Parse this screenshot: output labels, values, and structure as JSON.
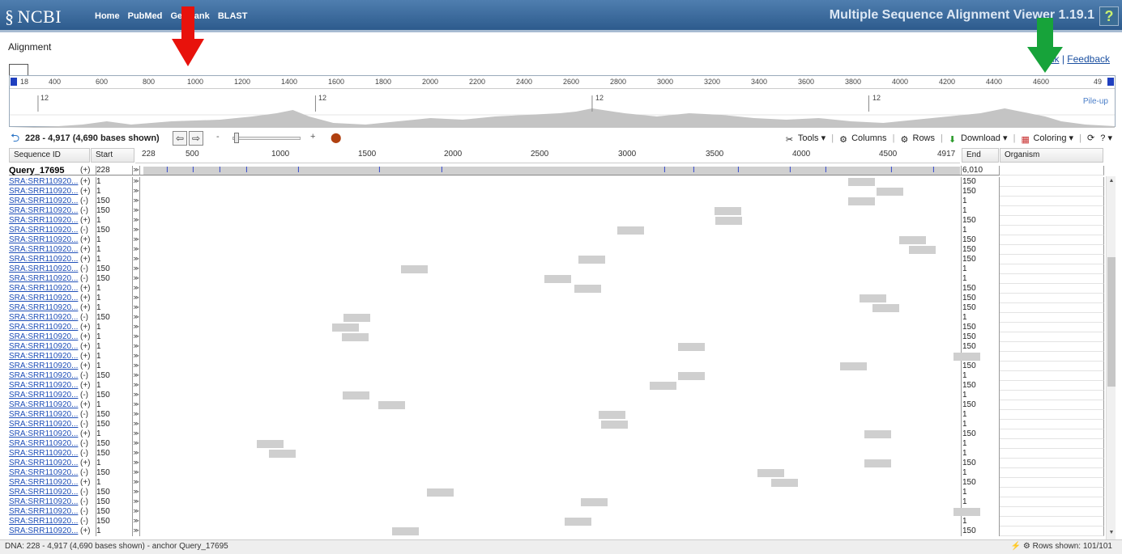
{
  "header": {
    "logo": "NCBI",
    "nav": [
      "Home",
      "PubMed",
      "GenBank",
      "BLAST"
    ],
    "app_title": "Multiple Sequence Alignment Viewer 1.19.1",
    "help": "?"
  },
  "alignment_label": "Alignment",
  "links": {
    "link": "Link",
    "feedback": "Feedback"
  },
  "overview": {
    "ticks": [
      "400",
      "600",
      "800",
      "1000",
      "1200",
      "1400",
      "1600",
      "1800",
      "2000",
      "2200",
      "2400",
      "2600",
      "2800",
      "3000",
      "3200",
      "3400",
      "3600",
      "3800",
      "4000",
      "4200",
      "4400",
      "4600",
      "49"
    ],
    "start_tick": "18",
    "pileup_label": "Pile-up",
    "pileup_marks": [
      "12",
      "12",
      "12",
      "12"
    ]
  },
  "toolbar": {
    "range": "228 - 4,917 (4,690 bases shown)",
    "zoom_minus": "-",
    "zoom_plus": "+",
    "tools": "Tools",
    "columns": "Columns",
    "rows": "Rows",
    "download": "Download",
    "coloring": "Coloring"
  },
  "columns": {
    "seq_id": "Sequence ID",
    "start": "Start",
    "end": "End",
    "organism": "Organism"
  },
  "alignment_ruler": [
    "228",
    "500",
    "1000",
    "1500",
    "2000",
    "2500",
    "3000",
    "3500",
    "4000",
    "4500",
    "4917"
  ],
  "query": {
    "id": "Query_17695",
    "strand": "(+)",
    "start": "228",
    "end": "6,010"
  },
  "rows": [
    {
      "id": "SRA:SRR110920...",
      "strand": "(+)",
      "start": "1",
      "end": "150"
    },
    {
      "id": "SRA:SRR110920...",
      "strand": "(+)",
      "start": "1",
      "end": "150"
    },
    {
      "id": "SRA:SRR110920...",
      "strand": "(-)",
      "start": "150",
      "end": "1"
    },
    {
      "id": "SRA:SRR110920...",
      "strand": "(-)",
      "start": "150",
      "end": "1"
    },
    {
      "id": "SRA:SRR110920...",
      "strand": "(+)",
      "start": "1",
      "end": "150"
    },
    {
      "id": "SRA:SRR110920...",
      "strand": "(-)",
      "start": "150",
      "end": "1"
    },
    {
      "id": "SRA:SRR110920...",
      "strand": "(+)",
      "start": "1",
      "end": "150"
    },
    {
      "id": "SRA:SRR110920...",
      "strand": "(+)",
      "start": "1",
      "end": "150"
    },
    {
      "id": "SRA:SRR110920...",
      "strand": "(+)",
      "start": "1",
      "end": "150"
    },
    {
      "id": "SRA:SRR110920...",
      "strand": "(-)",
      "start": "150",
      "end": "1"
    },
    {
      "id": "SRA:SRR110920...",
      "strand": "(-)",
      "start": "150",
      "end": "1"
    },
    {
      "id": "SRA:SRR110920...",
      "strand": "(+)",
      "start": "1",
      "end": "150"
    },
    {
      "id": "SRA:SRR110920...",
      "strand": "(+)",
      "start": "1",
      "end": "150"
    },
    {
      "id": "SRA:SRR110920...",
      "strand": "(+)",
      "start": "1",
      "end": "150"
    },
    {
      "id": "SRA:SRR110920...",
      "strand": "(-)",
      "start": "150",
      "end": "1"
    },
    {
      "id": "SRA:SRR110920...",
      "strand": "(+)",
      "start": "1",
      "end": "150"
    },
    {
      "id": "SRA:SRR110920...",
      "strand": "(+)",
      "start": "1",
      "end": "150"
    },
    {
      "id": "SRA:SRR110920...",
      "strand": "(+)",
      "start": "1",
      "end": "150"
    },
    {
      "id": "SRA:SRR110920...",
      "strand": "(+)",
      "start": "1",
      "end": "150"
    },
    {
      "id": "SRA:SRR110920...",
      "strand": "(+)",
      "start": "1",
      "end": "150"
    },
    {
      "id": "SRA:SRR110920...",
      "strand": "(-)",
      "start": "150",
      "end": "1"
    },
    {
      "id": "SRA:SRR110920...",
      "strand": "(+)",
      "start": "1",
      "end": "150"
    },
    {
      "id": "SRA:SRR110920...",
      "strand": "(-)",
      "start": "150",
      "end": "1"
    },
    {
      "id": "SRA:SRR110920...",
      "strand": "(+)",
      "start": "1",
      "end": "150"
    },
    {
      "id": "SRA:SRR110920...",
      "strand": "(-)",
      "start": "150",
      "end": "1"
    },
    {
      "id": "SRA:SRR110920...",
      "strand": "(-)",
      "start": "150",
      "end": "1"
    },
    {
      "id": "SRA:SRR110920...",
      "strand": "(+)",
      "start": "1",
      "end": "150"
    },
    {
      "id": "SRA:SRR110920...",
      "strand": "(-)",
      "start": "150",
      "end": "1"
    },
    {
      "id": "SRA:SRR110920...",
      "strand": "(-)",
      "start": "150",
      "end": "1"
    },
    {
      "id": "SRA:SRR110920...",
      "strand": "(+)",
      "start": "1",
      "end": "150"
    },
    {
      "id": "SRA:SRR110920...",
      "strand": "(-)",
      "start": "150",
      "end": "1"
    },
    {
      "id": "SRA:SRR110920...",
      "strand": "(+)",
      "start": "1",
      "end": "150"
    },
    {
      "id": "SRA:SRR110920...",
      "strand": "(-)",
      "start": "150",
      "end": "1"
    },
    {
      "id": "SRA:SRR110920...",
      "strand": "(-)",
      "start": "150",
      "end": "1"
    },
    {
      "id": "SRA:SRR110920...",
      "strand": "(-)",
      "start": "150",
      "end": "1"
    },
    {
      "id": "SRA:SRR110920...",
      "strand": "(-)",
      "start": "150",
      "end": "1"
    },
    {
      "id": "SRA:SRR110920...",
      "strand": "(+)",
      "start": "1",
      "end": "150"
    }
  ],
  "status": {
    "left": "DNA: 228 - 4,917 (4,690 bases shown) - anchor Query_17695",
    "right": "Rows shown: 101/101"
  },
  "colors": {
    "header": "#2d5b8d",
    "read": "#cfcfcf",
    "link": "#1f4fb8",
    "arrow_red": "#e8120c",
    "arrow_green": "#17a33a"
  }
}
